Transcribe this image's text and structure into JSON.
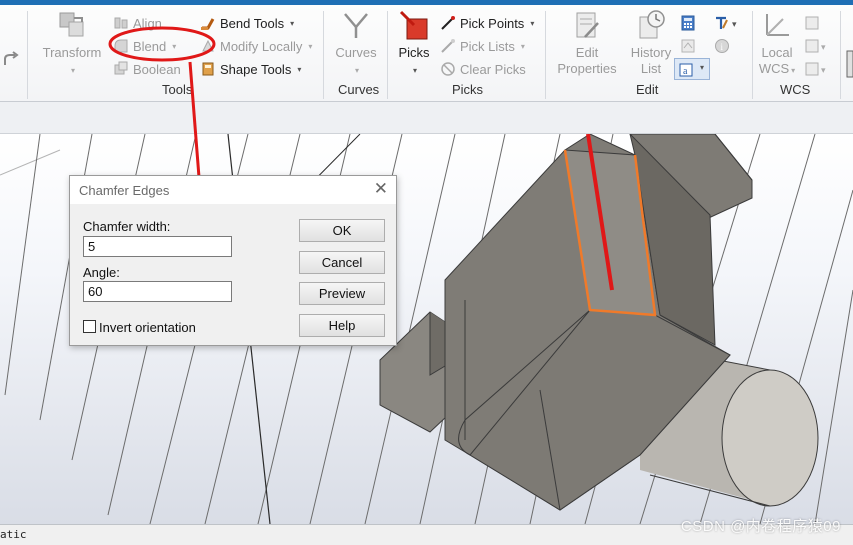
{
  "ribbon": {
    "transform": "Transform",
    "align": "Align",
    "blend": "Blend",
    "boolean": "Boolean",
    "bend_tools": "Bend Tools",
    "modify_locally": "Modify Locally",
    "shape_tools": "Shape Tools",
    "group_tools": "Tools",
    "curves_button": "Curves",
    "group_curves": "Curves",
    "picks_button": "Picks",
    "pick_points": "Pick Points",
    "pick_lists": "Pick Lists",
    "clear_picks": "Clear Picks",
    "group_picks": "Picks",
    "edit_properties_line1": "Edit",
    "edit_properties_line2": "Properties",
    "history_list_line1": "History",
    "history_list_line2": "List",
    "group_edit": "Edit",
    "local_wcs_line1": "Local",
    "local_wcs_line2": "WCS",
    "group_wcs": "WCS"
  },
  "dialog": {
    "title": "Chamfer Edges",
    "close": "✕",
    "chamfer_width_label": "Chamfer width:",
    "chamfer_width_value": "5",
    "angle_label": "Angle:",
    "angle_value": "60",
    "invert_label": "Invert orientation",
    "invert_checked": false,
    "ok": "OK",
    "cancel": "Cancel",
    "preview": "Preview",
    "help": "Help"
  },
  "status": {
    "text": "atic"
  },
  "watermark": "CSDN @内卷程序猿09",
  "colors": {
    "accent_blue": "#1f6fb5",
    "annotation_red": "#e01818",
    "highlight_orange": "#f07a2a",
    "model_gray": "#7a7872"
  },
  "icons": [
    "transform-icon",
    "align-icon",
    "blend-icon",
    "boolean-icon",
    "bend-tools-icon",
    "modify-locally-icon",
    "shape-tools-icon",
    "curves-icon",
    "picks-icon",
    "pick-points-icon",
    "pick-lists-icon",
    "clear-picks-icon",
    "edit-properties-icon",
    "history-list-icon",
    "calculator-icon",
    "wcs-icon"
  ]
}
